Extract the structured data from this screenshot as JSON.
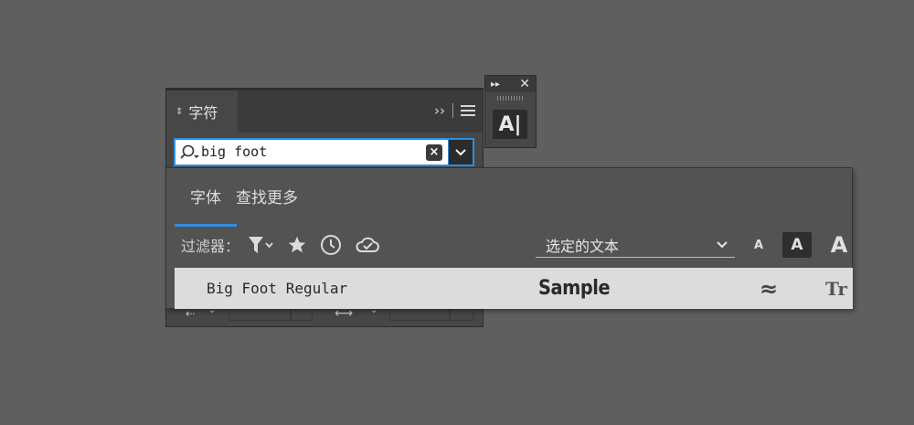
{
  "character_panel": {
    "tab_label": "字符",
    "sort_icon": "up-down-arrows",
    "expand_icon": "double-chevron-right",
    "menu_icon": "hamburger"
  },
  "search": {
    "value": "big foot",
    "clear_icon": "close-x",
    "dropdown_icon": "chevron-down"
  },
  "mini_panel": {
    "collapse_icon": "double-chevron-right",
    "close_icon": "close-x",
    "tool_label": "A|"
  },
  "font_dropdown": {
    "tabs": [
      {
        "label": "字体",
        "active": true
      },
      {
        "label": "查找更多",
        "active": false
      }
    ],
    "filter_label": "过滤器：",
    "filter_icons": [
      "funnel-icon",
      "star-icon",
      "clock-icon",
      "cloud-check-icon"
    ],
    "preview_select": "选定的文本",
    "size_buttons": {
      "small": "A",
      "medium": "A",
      "large": "A"
    },
    "results": [
      {
        "name": "Big Foot Regular",
        "sample": "Sample",
        "similar": "≈",
        "type": "Tr"
      }
    ]
  },
  "colors": {
    "background": "#5f5f5f",
    "panel": "#474747",
    "accent": "#2f8fe0",
    "row_highlight": "#dcdcdc"
  }
}
